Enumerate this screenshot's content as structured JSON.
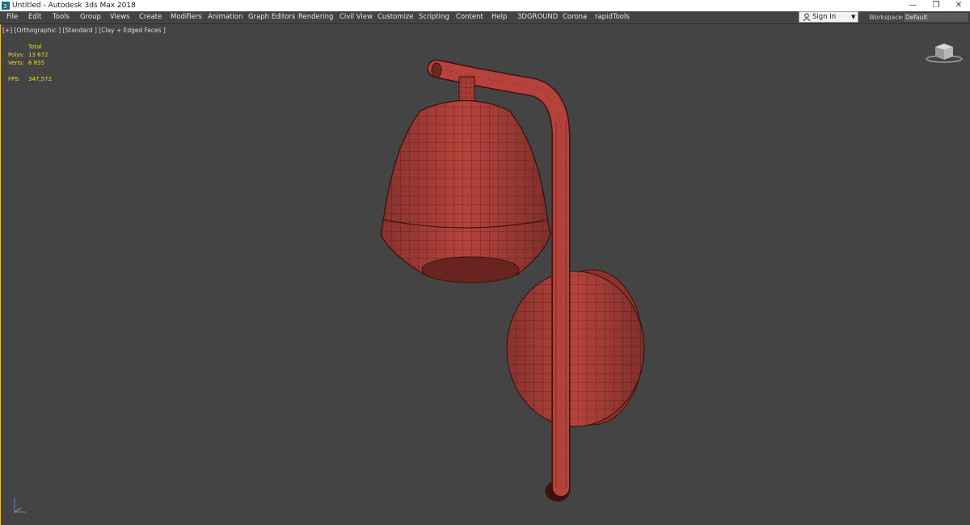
{
  "window": {
    "title": "Untitled - Autodesk 3ds Max 2018",
    "controls": {
      "minimize": "—",
      "restore": "❐",
      "close": "✕"
    }
  },
  "menu": [
    {
      "label": "File"
    },
    {
      "label": "Edit"
    },
    {
      "label": "Tools"
    },
    {
      "label": "Group"
    },
    {
      "label": "Views"
    },
    {
      "label": "Create"
    },
    {
      "label": "Modifiers"
    },
    {
      "label": "Animation"
    },
    {
      "label": "Graph Editors"
    },
    {
      "label": "Rendering"
    },
    {
      "label": "Civil View"
    },
    {
      "label": "Customize"
    },
    {
      "label": "Scripting"
    },
    {
      "label": "Content"
    },
    {
      "label": "Help"
    },
    {
      "label": "3DGROUND"
    },
    {
      "label": "Corona"
    },
    {
      "label": "rapidTools"
    }
  ],
  "account": {
    "signin": "Sign In",
    "workspaces_label": "Workspaces:",
    "workspace": "Default"
  },
  "viewport": {
    "labels": "[+] [Orthographic ] [Standard ] [Clay + Edged Faces ]",
    "stats": {
      "header": "Total",
      "polys_label": "Polys:",
      "polys": "13 672",
      "verts_label": "Verts:",
      "verts": "6 855",
      "fps_label": "FPS:",
      "fps": "347,572"
    }
  },
  "colors": {
    "viewport_bg": "#444444",
    "model": "#b5433c",
    "active_border": "#f0c000",
    "stats": "#e8e000"
  },
  "icons": {
    "app": "3ds-max-icon",
    "user": "user-icon",
    "viewcube": "viewcube-icon",
    "axis": "axis-tripod-icon"
  }
}
